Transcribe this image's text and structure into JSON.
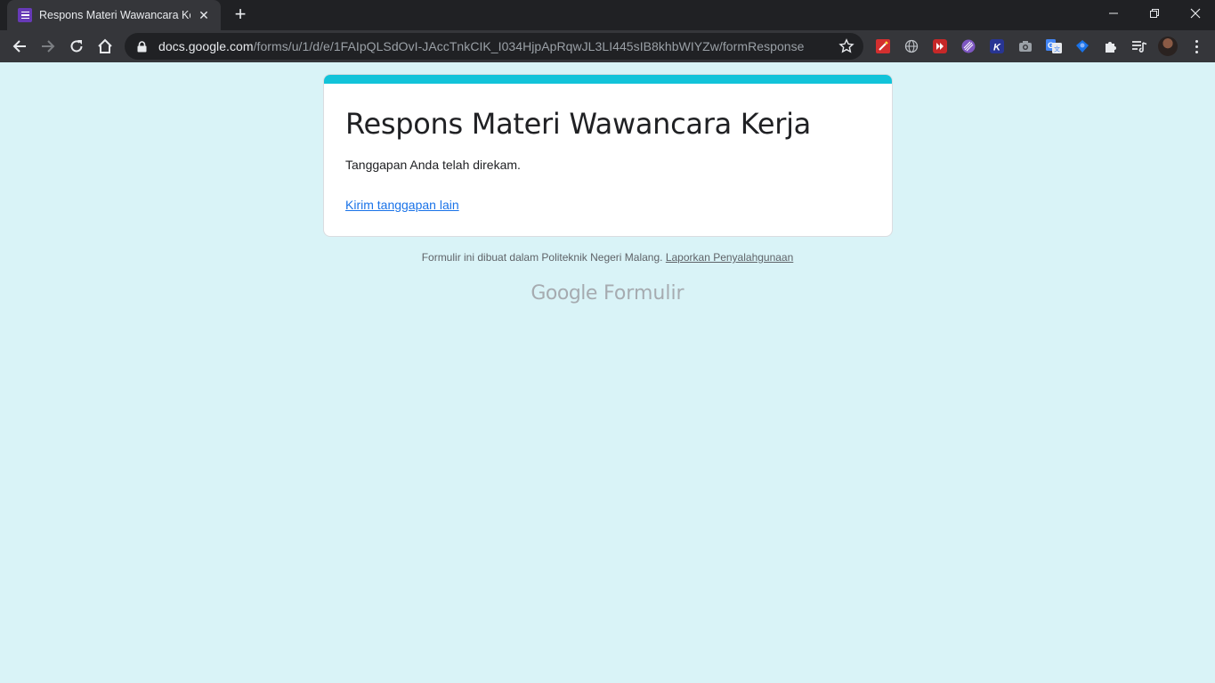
{
  "browser": {
    "tab_title": "Respons Materi Wawancara Kerja",
    "url_host": "docs.google.com",
    "url_path": "/forms/u/1/d/e/1FAIpQLSdOvI-JAccTnkCIK_I034HjpApRqwJL3LI445sIB8khbWIYZw/formResponse"
  },
  "form": {
    "title": "Respons Materi Wawancara Kerja",
    "confirmation": "Tanggapan Anda telah direkam.",
    "submit_another": "Kirim tanggapan lain",
    "accent_color": "#12c3d9"
  },
  "footer": {
    "text": "Formulir ini dibuat dalam Politeknik Negeri Malang.",
    "report_link": "Laporkan Penyalahgunaan",
    "brand_google": "Google",
    "brand_product": "Formulir"
  },
  "icons": {
    "extensions": [
      "pen-icon",
      "globe-icon",
      "video-icon",
      "pattern-icon",
      "k-icon",
      "camera-icon",
      "translate-icon",
      "shield-icon",
      "puzzle-icon",
      "reading-list-icon"
    ]
  },
  "colors": {
    "page_background": "#d9f3f7",
    "link": "#1a73e8"
  }
}
